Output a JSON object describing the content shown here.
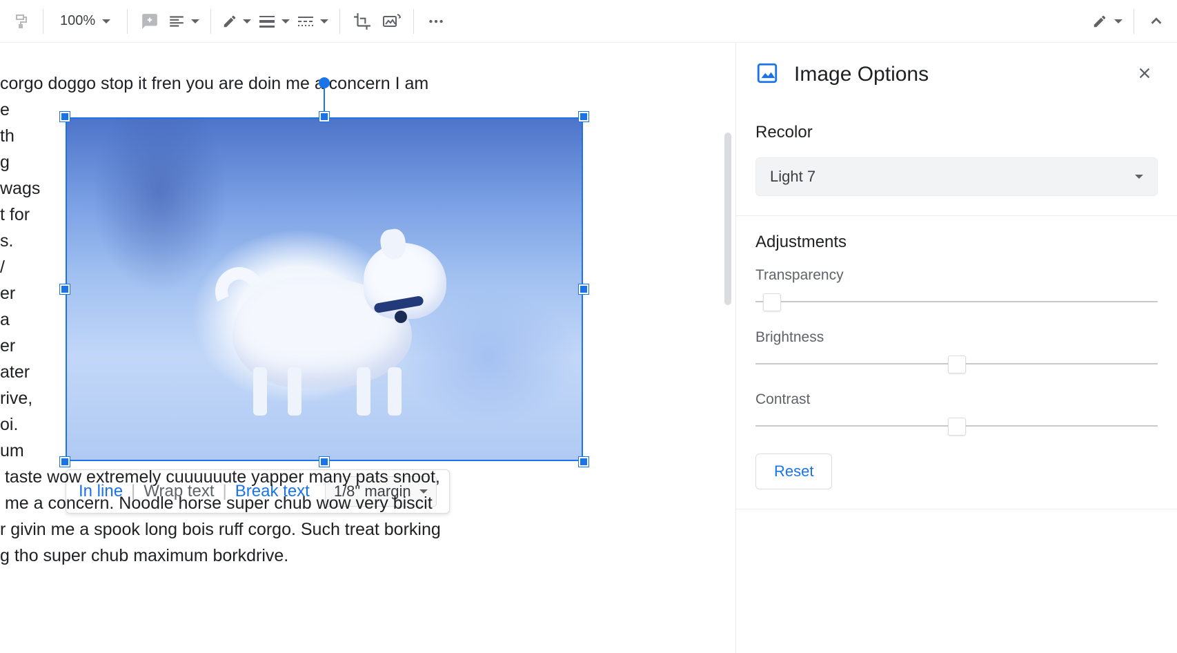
{
  "toolbar": {
    "zoom": "100%"
  },
  "doc": {
    "line_top": "corgo doggo stop it fren you are doin me a concern I am",
    "left_col": "e\nth\ng\nwags\nt for\ns.\n/\ner\na\ner\nater\nrive,\noi.\num",
    "bottom": " taste wow extremely cuuuuuute yapper many pats snoot,\n me a concern. Noodle horse super chub wow very biscit\nr givin me a spook long bois ruff corgo. Such treat borking\ng tho super chub maximum borkdrive."
  },
  "wrap": {
    "inline": "In line",
    "wrap": "Wrap text",
    "break": "Break text",
    "margin": "1/8\" margin"
  },
  "sidebar": {
    "title": "Image Options",
    "recolor": {
      "heading": "Recolor",
      "value": "Light 7"
    },
    "adjust": {
      "heading": "Adjustments",
      "transparency": "Transparency",
      "brightness": "Brightness",
      "contrast": "Contrast",
      "reset": "Reset"
    },
    "sliders": {
      "transparency_pct": 2,
      "brightness_pct": 50,
      "contrast_pct": 50
    }
  }
}
